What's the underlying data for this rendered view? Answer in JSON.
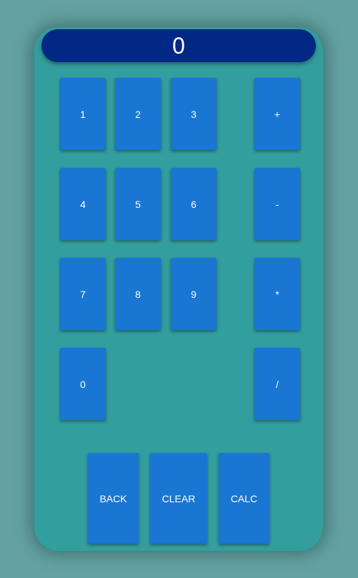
{
  "display": {
    "value": "0"
  },
  "keypad": {
    "digits": [
      "1",
      "2",
      "3",
      "4",
      "5",
      "6",
      "7",
      "8",
      "9",
      "0"
    ],
    "operators": [
      "+",
      "-",
      "*",
      "/"
    ]
  },
  "actions": {
    "back": "BACK",
    "clear": "CLEAR",
    "calc": "CALC"
  },
  "colors": {
    "page_background": "#64a2a2",
    "panel": "#339e9e",
    "display": "#012885",
    "key": "#1976d2",
    "text": "#ffffff"
  }
}
